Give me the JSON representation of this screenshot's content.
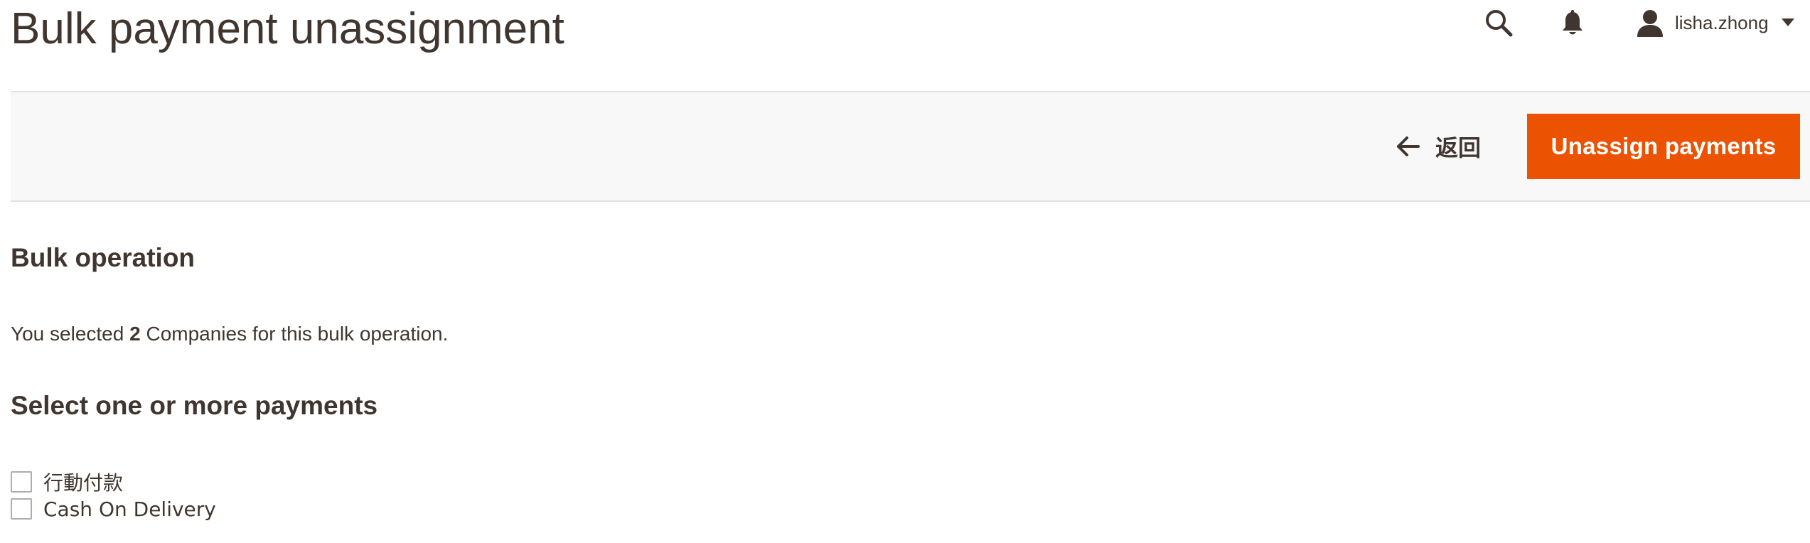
{
  "header": {
    "title": "Bulk payment unassignment",
    "icons": {
      "search": "search-icon",
      "notifications": "bell-icon",
      "user": "user-icon",
      "caret": "caret-down-icon"
    },
    "user_name": "lisha.zhong"
  },
  "action_bar": {
    "back_label": "返回",
    "primary_label": "Unassign payments",
    "primary_color": "#eb5202"
  },
  "bulk_section": {
    "title": "Bulk operation",
    "text_before": "You selected",
    "count": "2",
    "text_after": "Companies for this bulk operation."
  },
  "payments_section": {
    "title": "Select one or more payments",
    "options": [
      {
        "label": "行動付款",
        "checked": false
      },
      {
        "label": "Cash On Delivery",
        "checked": false
      }
    ]
  },
  "colors": {
    "text": "#41362f",
    "accent": "#eb5202",
    "bar_bg": "#f8f8f8",
    "divider": "#e3e3e3"
  }
}
